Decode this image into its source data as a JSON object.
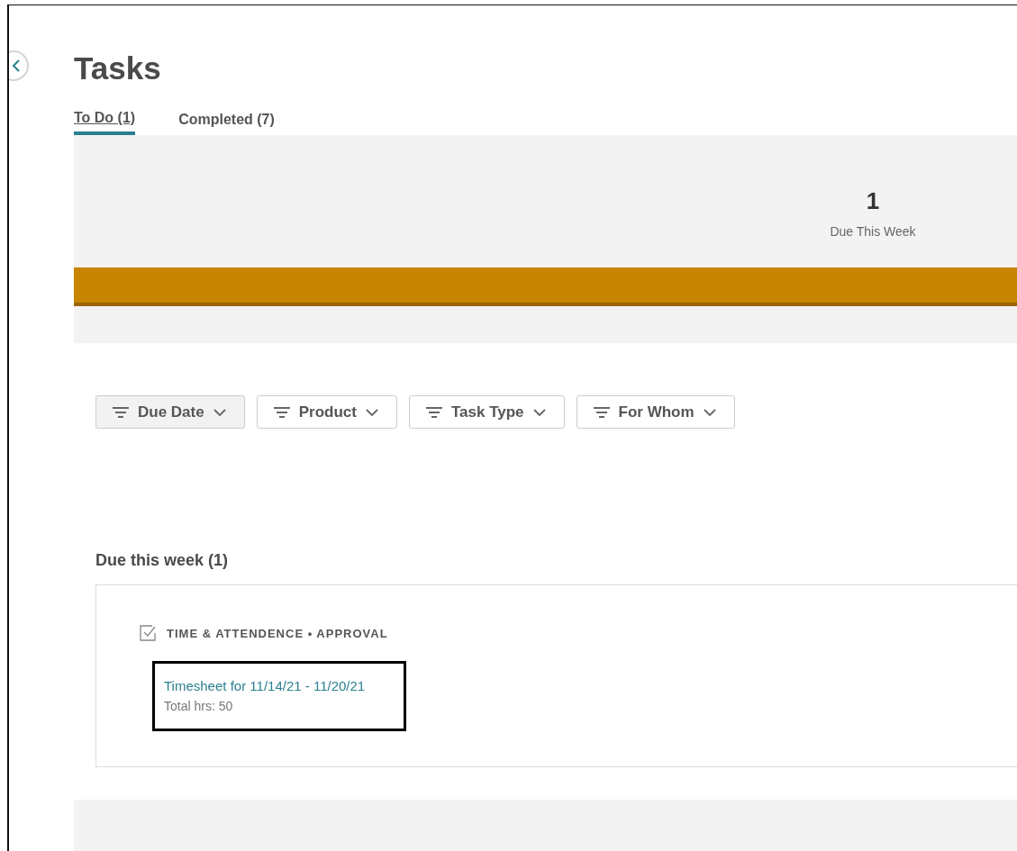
{
  "page": {
    "title": "Tasks"
  },
  "tabs": [
    {
      "label": "To Do (1)",
      "selected": true
    },
    {
      "label": "Completed (7)",
      "selected": false
    }
  ],
  "summary": {
    "count": "1",
    "label": "Due This Week"
  },
  "filters": [
    {
      "label": "Due Date",
      "selected": true
    },
    {
      "label": "Product",
      "selected": false
    },
    {
      "label": "Task Type",
      "selected": false
    },
    {
      "label": "For Whom",
      "selected": false
    }
  ],
  "section": {
    "title": "Due this week (1)"
  },
  "tasks": [
    {
      "category": "TIME & ATTENDENCE • APPROVAL",
      "title": "Timesheet for 11/14/21 - 11/20/21",
      "detail": "Total hrs: 50",
      "highlighted": true
    }
  ]
}
